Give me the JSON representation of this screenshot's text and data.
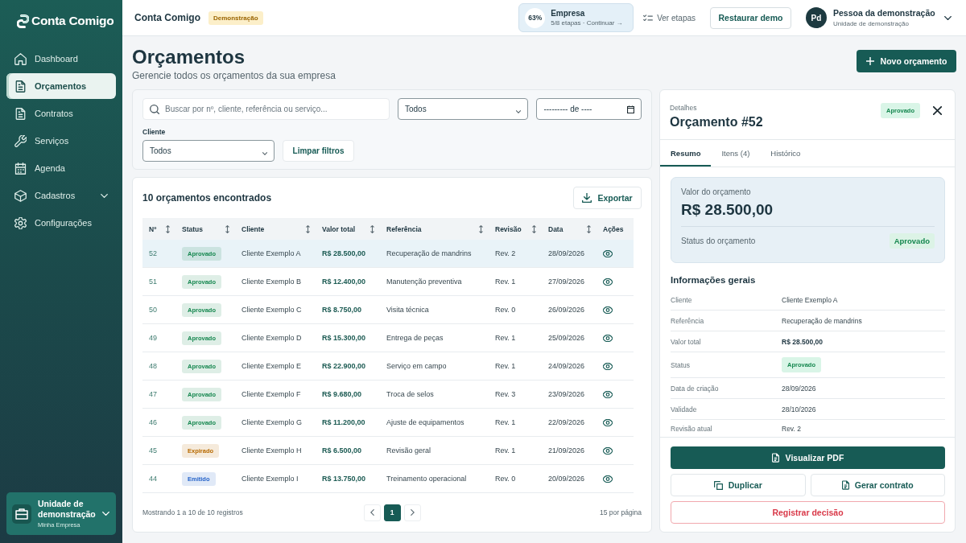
{
  "sidebar": {
    "logo": "Conta Comigo",
    "items": [
      {
        "label": "Dashboard",
        "selected": false,
        "has_submenu": false
      },
      {
        "label": "Orçamentos",
        "selected": true,
        "has_submenu": false
      },
      {
        "label": "Contratos",
        "selected": false,
        "has_submenu": false
      },
      {
        "label": "Serviços",
        "selected": false,
        "has_submenu": false
      },
      {
        "label": "Agenda",
        "selected": false,
        "has_submenu": false
      },
      {
        "label": "Cadastros",
        "selected": false,
        "has_submenu": true
      },
      {
        "label": "Configurações",
        "selected": false,
        "has_submenu": false
      }
    ],
    "unit": {
      "title": "Unidade de demonstração",
      "subtitle": "Minha Empresa"
    }
  },
  "header": {
    "app_name": "Conta Comigo",
    "badge": "Demonstração",
    "setup": {
      "percent": "63%",
      "title": "Empresa",
      "subtitle": "5/8 etapas · Continuar →"
    },
    "steps_link": "Ver etapas",
    "restore_button": "Restaurar demo",
    "user": {
      "initials": "Pd",
      "name": "Pessoa da demonstração",
      "unit": "Unidade de demonstração"
    }
  },
  "page": {
    "title": "Orçamentos",
    "subtitle": "Gerencie todos os orçamentos da sua empresa",
    "new_button": "Novo orçamento"
  },
  "filters": {
    "search": {
      "placeholder": "Buscar por nº, cliente, referência ou serviço..."
    },
    "status_select": "Todos",
    "period": "--------- de ----",
    "client_label": "Cliente",
    "client_select": "Todos",
    "clear_button": "Limpar filtros"
  },
  "table": {
    "title": "10 orçamentos encontrados",
    "export_button": "Exportar",
    "columns": [
      {
        "label": "Nº",
        "sortable": true
      },
      {
        "label": "Status",
        "sortable": true
      },
      {
        "label": "Cliente",
        "sortable": true
      },
      {
        "label": "Valor total",
        "sortable": true
      },
      {
        "label": "Referência",
        "sortable": true
      },
      {
        "label": "Revisão",
        "sortable": true
      },
      {
        "label": "Data",
        "sortable": true
      },
      {
        "label": "Ações",
        "sortable": false
      }
    ],
    "rows": [
      {
        "number": "52",
        "status": "Aprovado",
        "color": "#15874f",
        "client": "Cliente Exemplo A",
        "total": "R$ 28.500,00",
        "reference": "Recuperação de mandrins",
        "revision": "Rev. 2",
        "date": "28/09/2026",
        "selected": true
      },
      {
        "number": "51",
        "status": "Aprovado",
        "color": "#15874f",
        "client": "Cliente Exemplo B",
        "total": "R$ 12.400,00",
        "reference": "Manutenção preventiva",
        "revision": "Rev. 1",
        "date": "27/09/2026",
        "selected": false
      },
      {
        "number": "50",
        "status": "Aprovado",
        "color": "#15874f",
        "client": "Cliente Exemplo C",
        "total": "R$ 8.750,00",
        "reference": "Visita técnica",
        "revision": "Rev. 0",
        "date": "26/09/2026",
        "selected": false
      },
      {
        "number": "49",
        "status": "Aprovado",
        "color": "#15874f",
        "client": "Cliente Exemplo D",
        "total": "R$ 15.300,00",
        "reference": "Entrega de peças",
        "revision": "Rev. 1",
        "date": "25/09/2026",
        "selected": false
      },
      {
        "number": "48",
        "status": "Aprovado",
        "color": "#15874f",
        "client": "Cliente Exemplo E",
        "total": "R$ 22.900,00",
        "reference": "Serviço em campo",
        "revision": "Rev. 1",
        "date": "24/09/2026",
        "selected": false
      },
      {
        "number": "47",
        "status": "Aprovado",
        "color": "#15874f",
        "client": "Cliente Exemplo F",
        "total": "R$ 9.680,00",
        "reference": "Troca de selos",
        "revision": "Rev. 3",
        "date": "23/09/2026",
        "selected": false
      },
      {
        "number": "46",
        "status": "Aprovado",
        "color": "#15874f",
        "client": "Cliente Exemplo G",
        "total": "R$ 11.200,00",
        "reference": "Ajuste de equipamentos",
        "revision": "Rev. 1",
        "date": "22/09/2026",
        "selected": false
      },
      {
        "number": "45",
        "status": "Expirado",
        "color": "#b86a00",
        "client": "Cliente Exemplo H",
        "total": "R$ 6.500,00",
        "reference": "Revisão geral",
        "revision": "Rev. 1",
        "date": "21/09/2026",
        "selected": false
      },
      {
        "number": "44",
        "status": "Emitido",
        "color": "#2563c9",
        "client": "Cliente Exemplo I",
        "total": "R$ 13.750,00",
        "reference": "Treinamento operacional",
        "revision": "Rev. 0",
        "date": "20/09/2026",
        "selected": false
      }
    ],
    "footer": {
      "summary": "Mostrando 1 a 10 de 10 registros",
      "pages": [
        {
          "label": "1",
          "selected": true
        }
      ],
      "per_page": "15 por página"
    }
  },
  "details": {
    "caption": "Detalhes",
    "title": "Orçamento #52",
    "status": "Aprovado",
    "tabs": [
      {
        "label": "Resumo",
        "selected": true
      },
      {
        "label": "Itens (4)",
        "selected": false
      },
      {
        "label": "Histórico",
        "selected": false
      }
    ],
    "summary": {
      "value_label": "Valor do orçamento",
      "value": "R$ 28.500,00",
      "status_label": "Status do orçamento",
      "status": "Aprovado"
    },
    "info_title": "Informações gerais",
    "info": [
      {
        "label": "Cliente",
        "value": "Cliente Exemplo A",
        "kind": "text"
      },
      {
        "label": "Referência",
        "value": "Recuperação de mandrins",
        "kind": "text"
      },
      {
        "label": "Valor total",
        "value": "R$ 28.500,00",
        "kind": "strong"
      },
      {
        "label": "Status",
        "value": "Aprovado",
        "kind": "badge"
      },
      {
        "label": "Data de criação",
        "value": "28/09/2026",
        "kind": "text"
      },
      {
        "label": "Validade",
        "value": "28/10/2026",
        "kind": "text"
      },
      {
        "label": "Revisão atual",
        "value": "Rev. 2",
        "kind": "text"
      }
    ],
    "pdf_button": "Visualizar PDF",
    "duplicate_button": "Duplicar",
    "contract_button": "Gerar contrato",
    "decision_button": "Registrar decisão"
  }
}
